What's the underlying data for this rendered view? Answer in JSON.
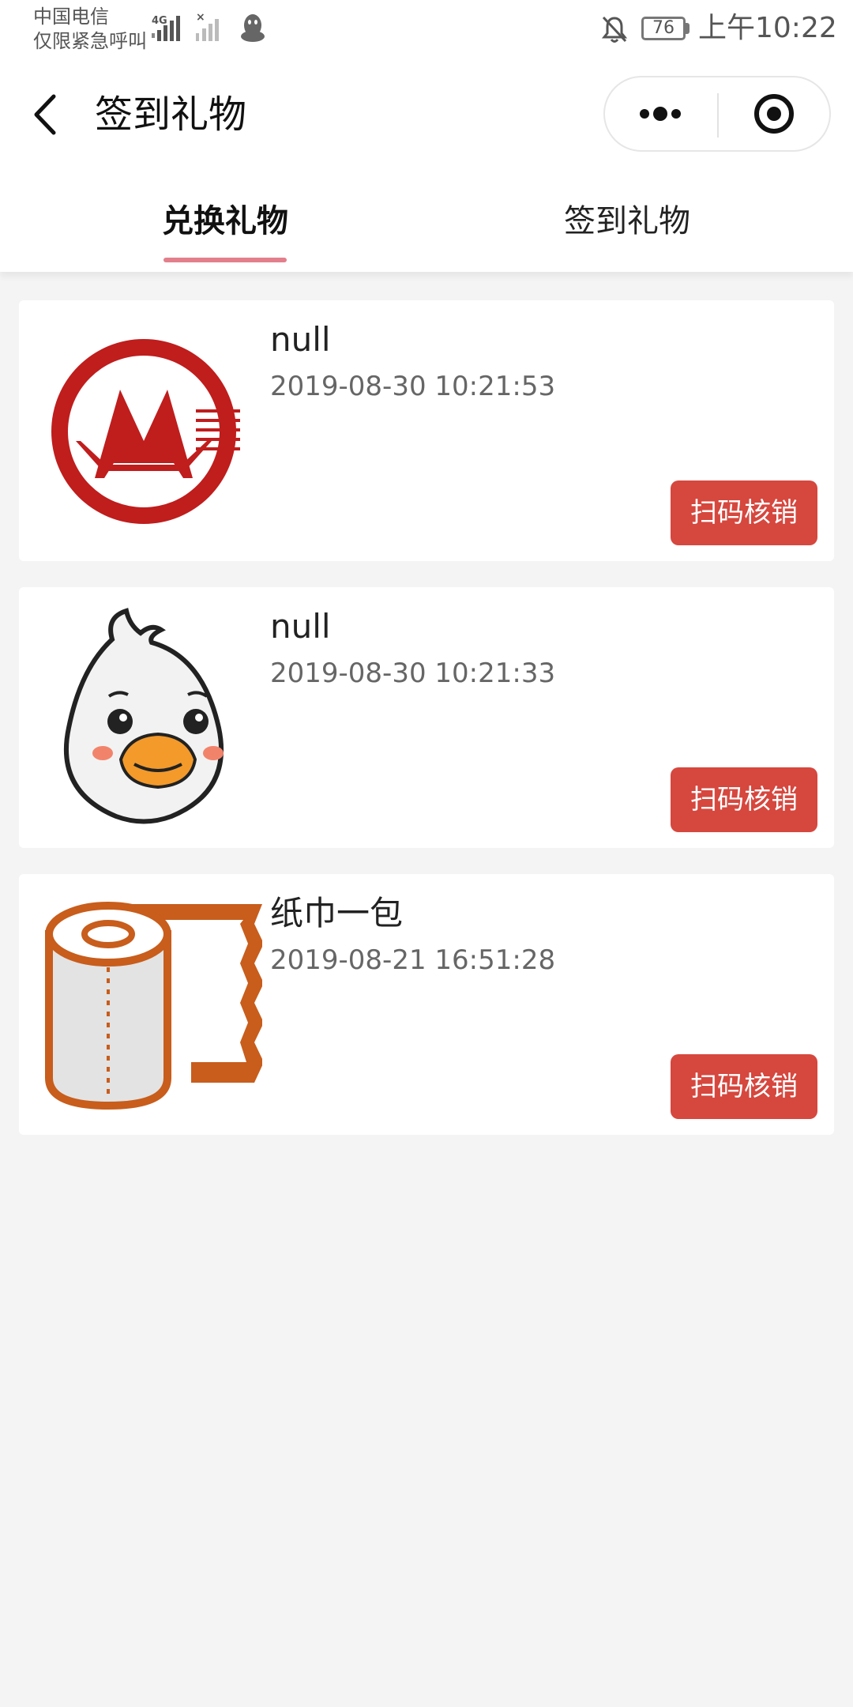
{
  "status_bar": {
    "carrier_line1": "中国电信",
    "carrier_line2": "仅限紧急呼叫",
    "network": "4G",
    "battery": "76",
    "time": "上午10:22"
  },
  "nav": {
    "title": "签到礼物"
  },
  "tabs": [
    {
      "label": "兑换礼物",
      "active": true
    },
    {
      "label": "签到礼物",
      "active": false
    }
  ],
  "gifts": [
    {
      "name": "null",
      "time": "2019-08-30 10:21:53",
      "button": "扫码核销",
      "image": "bank-logo"
    },
    {
      "name": "null",
      "time": "2019-08-30 10:21:33",
      "button": "扫码核销",
      "image": "duck-face"
    },
    {
      "name": "纸巾一包",
      "time": "2019-08-21 16:51:28",
      "button": "扫码核销",
      "image": "tissue-roll"
    }
  ],
  "colors": {
    "accent_underline": "#e27f8c",
    "button_red": "#d6473e",
    "page_background": "#f4f4f4"
  }
}
